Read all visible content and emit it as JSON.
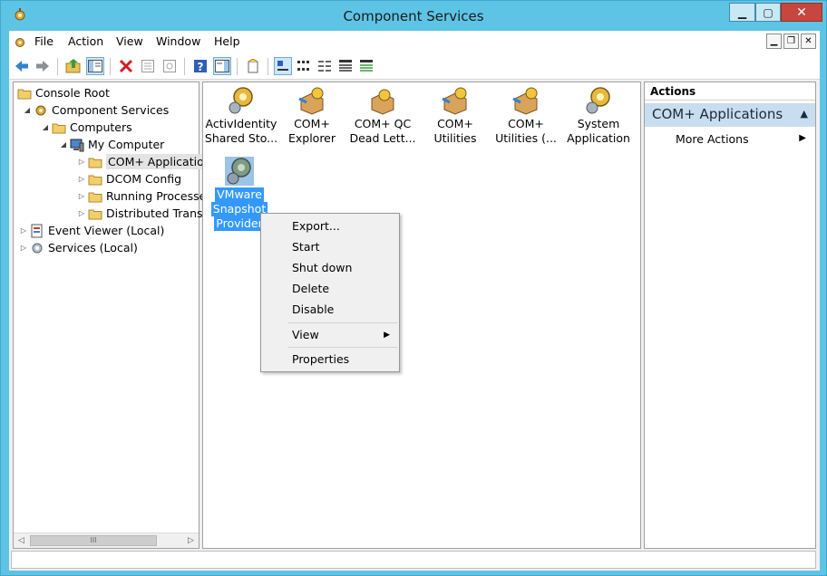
{
  "window": {
    "title": "Component Services",
    "controls": {
      "minimize": "▁",
      "maximize": "▢",
      "close": "✕"
    }
  },
  "menubar": {
    "items": [
      "File",
      "Action",
      "View",
      "Window",
      "Help"
    ],
    "mdi_controls": [
      "▁",
      "❐",
      "✕"
    ]
  },
  "toolbar": {
    "buttons": [
      "back-icon",
      "forward-icon",
      "up-folder-icon",
      "show-hide-tree-icon",
      "delete-icon",
      "properties-icon",
      "export-list-icon",
      "help-icon",
      "show-hide-action-pane-icon",
      "new-icon",
      "large-icons-view",
      "small-icons-view",
      "list-view",
      "detail-view",
      "status-view"
    ]
  },
  "tree": {
    "items": [
      {
        "label": "Console Root"
      },
      {
        "label": "Component Services"
      },
      {
        "label": "Computers"
      },
      {
        "label": "My Computer"
      },
      {
        "label": "COM+ Applicatio"
      },
      {
        "label": "DCOM Config"
      },
      {
        "label": "Running Processe"
      },
      {
        "label": "Distributed Transa"
      },
      {
        "label": "Event Viewer (Local)"
      },
      {
        "label": "Services (Local)"
      }
    ],
    "scroll_thumb": "III",
    "scroll_left": "◁",
    "scroll_right": "▷"
  },
  "apps": [
    {
      "line1": "ActivIdentity",
      "line2": "Shared Sto..."
    },
    {
      "line1": "COM+",
      "line2": "Explorer"
    },
    {
      "line1": "COM+ QC",
      "line2": "Dead Lett..."
    },
    {
      "line1": "COM+",
      "line2": "Utilities"
    },
    {
      "line1": "COM+",
      "line2": "Utilities (..."
    },
    {
      "line1": "System",
      "line2": "Application"
    },
    {
      "line1": "VMware",
      "line2": "Snapshot",
      "line3": "Provider"
    }
  ],
  "actions": {
    "header": "Actions",
    "section": "COM+ Applications",
    "item": "More Actions",
    "collapse": "▲",
    "arrow": "▶"
  },
  "context_menu": {
    "items": [
      "Export...",
      "Start",
      "Shut down",
      "Delete",
      "Disable",
      "View",
      "Properties"
    ],
    "submenu_arrow": "▶"
  },
  "colors": {
    "window_frame": "#5ec4e6",
    "selection": "#3399ff",
    "action_section": "#c8def0"
  }
}
